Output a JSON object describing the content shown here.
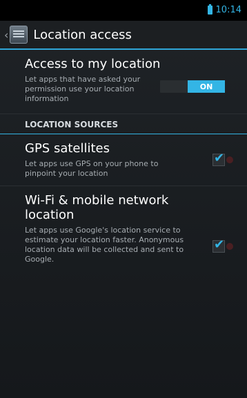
{
  "status_bar": {
    "time": "10:14"
  },
  "action_bar": {
    "up_glyph": "‹",
    "title": "Location access"
  },
  "access_pref": {
    "title": "Access to my location",
    "summary": "Let apps that have asked your permission use your location information",
    "toggle_label": "ON"
  },
  "category": {
    "label": "LOCATION SOURCES"
  },
  "gps_pref": {
    "title": "GPS satellites",
    "summary": "Let apps use GPS on your phone to pinpoint your location",
    "checked": true
  },
  "wifi_pref": {
    "title": "Wi-Fi & mobile network location",
    "summary": "Let apps use Google's location service to estimate your location faster. Anonymous location data will be collected and sent to Google.",
    "checked": true
  },
  "colors": {
    "accent": "#33b5e5",
    "background": "#1b1e21"
  }
}
